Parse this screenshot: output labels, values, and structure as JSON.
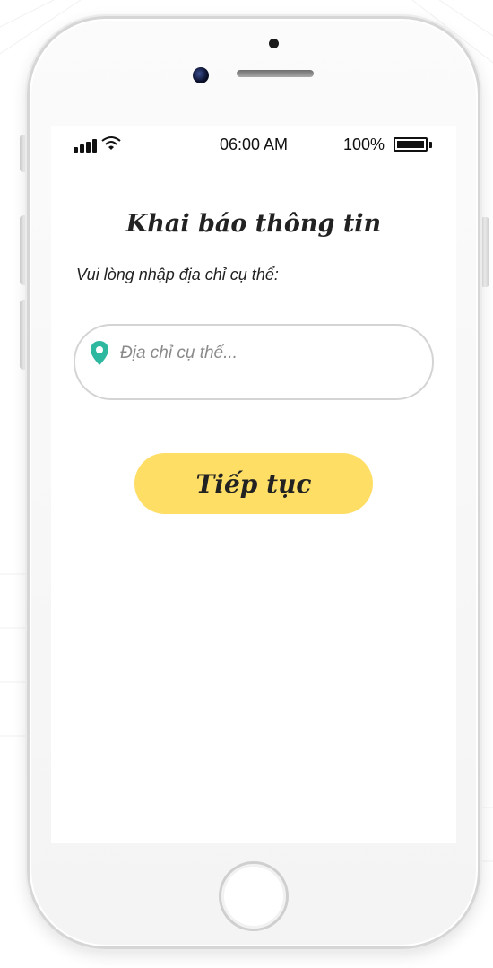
{
  "status_bar": {
    "time": "06:00 AM",
    "battery_percent": "100%",
    "battery_level": 1.0,
    "signal_bars": 4,
    "wifi_icon": "wifi-icon"
  },
  "form": {
    "title": "Khai báo thông tin",
    "subtitle": "Vui lòng nhập địa chỉ cụ thể:",
    "address": {
      "placeholder": "Địa chỉ cụ thể...",
      "value": "",
      "icon": "location-pin-icon"
    },
    "continue_label": "Tiếp tục"
  },
  "colors": {
    "button": "#ffde66",
    "pin": "#2fb8a0",
    "text": "#222222"
  }
}
